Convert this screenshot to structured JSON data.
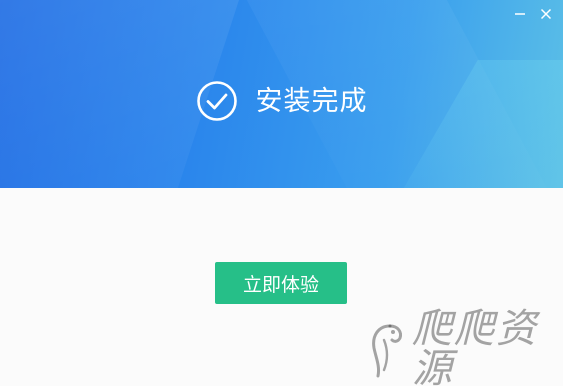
{
  "window": {
    "controls": {
      "minimize_icon": "minimize-icon",
      "close_icon": "close-icon"
    }
  },
  "header": {
    "status_icon": "check-circle-icon",
    "title": "安装完成"
  },
  "main": {
    "action_label": "立即体验"
  },
  "watermark": {
    "logo_icon": "parrot-logo-icon",
    "text": "爬爬资源"
  },
  "colors": {
    "header_gradient_start": "#1e6ce4",
    "header_gradient_end": "#5cc0e6",
    "button": "#26bf88",
    "body_bg": "#fbfbfb"
  }
}
